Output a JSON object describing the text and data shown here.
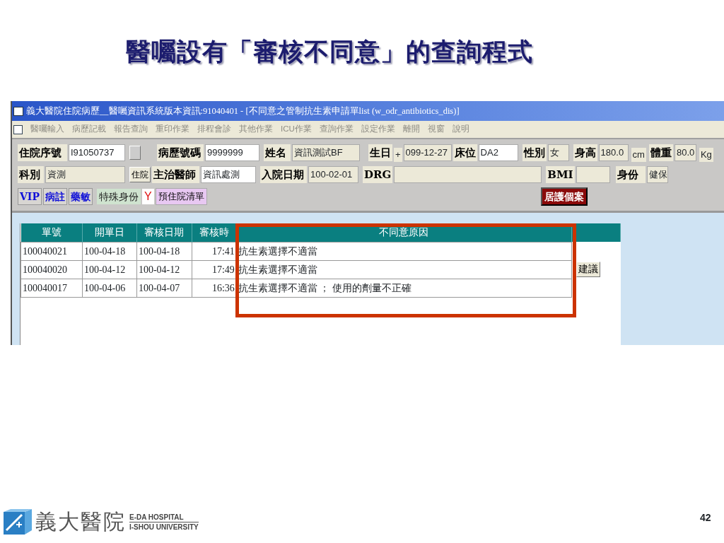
{
  "slide_title": "醫囑設有「審核不同意」的查詢程式",
  "window": {
    "title": "義大醫院住院病歷__醫囑資訊系統版本資訊:91040401 - [不同意之管制抗生素申請單list (w_odr_antibiotics_dis)]"
  },
  "menu": [
    "醫囑輸入",
    "病歷記載",
    "報告查詢",
    "重印作業",
    "排程會診",
    "其他作業",
    "ICU作業",
    "查詢作業",
    "設定作業",
    "離開",
    "視窗",
    "說明"
  ],
  "form_rows": [
    [
      {
        "kind": "label",
        "text": "住院序號"
      },
      {
        "kind": "field",
        "text": "I91050737",
        "readonly": false
      },
      {
        "kind": "blank-button"
      },
      {
        "kind": "label",
        "text": "病歷號碼"
      },
      {
        "kind": "field",
        "text": "9999999",
        "readonly": false
      },
      {
        "kind": "label",
        "text": "姓名"
      },
      {
        "kind": "field",
        "text": "資訊測試BF",
        "readonly": true
      },
      {
        "kind": "label",
        "text": "生日"
      },
      {
        "kind": "unit",
        "text": "+"
      },
      {
        "kind": "field",
        "text": "099-12-27",
        "readonly": true
      },
      {
        "kind": "label",
        "text": "床位"
      },
      {
        "kind": "field",
        "text": "DA2",
        "readonly": false
      },
      {
        "kind": "label",
        "text": "性別"
      },
      {
        "kind": "field",
        "text": "女",
        "readonly": true
      },
      {
        "kind": "label",
        "text": "身高"
      },
      {
        "kind": "field",
        "text": "180.0",
        "readonly": true
      },
      {
        "kind": "unit",
        "text": "cm"
      },
      {
        "kind": "label",
        "text": "體重"
      },
      {
        "kind": "field",
        "text": "80.0",
        "readonly": true
      },
      {
        "kind": "unit",
        "text": "Kg"
      }
    ],
    [
      {
        "kind": "label",
        "text": "科別"
      },
      {
        "kind": "field",
        "text": "資測",
        "readonly": true
      },
      {
        "kind": "small-button",
        "text": "住院"
      },
      {
        "kind": "label",
        "text": "主治醫師"
      },
      {
        "kind": "field",
        "text": "資訊處測",
        "readonly": false
      },
      {
        "kind": "label",
        "text": "入院日期"
      },
      {
        "kind": "field",
        "text": "100-02-01",
        "readonly": true
      },
      {
        "kind": "label",
        "text": "DRG"
      },
      {
        "kind": "field",
        "readonly": true
      },
      {
        "kind": "label",
        "text": "BMI"
      },
      {
        "kind": "field",
        "readonly": true
      },
      {
        "kind": "label",
        "text": "身份"
      },
      {
        "kind": "field",
        "text": "健保",
        "readonly": true
      }
    ],
    [
      {
        "kind": "alert-button",
        "text": "VIP"
      },
      {
        "kind": "alert-button",
        "text": "病註"
      },
      {
        "kind": "alert-button",
        "text": "藥敏"
      },
      {
        "kind": "special-label",
        "text": "特殊身份"
      },
      {
        "kind": "flag",
        "text": "Y"
      },
      {
        "kind": "list-button",
        "text": "預住院清單"
      },
      {
        "kind": "case-button",
        "text": "居護個案"
      }
    ]
  ],
  "table": {
    "columns": [
      "單號",
      "開單日",
      "審核日期",
      "審核時",
      "不同意原因"
    ],
    "rows": [
      [
        "100040021",
        "100-04-18",
        "100-04-18",
        "17:41",
        "抗生素選擇不適當"
      ],
      [
        "100040020",
        "100-04-12",
        "100-04-12",
        "17:49",
        "抗生素選擇不適當"
      ],
      [
        "100040017",
        "100-04-06",
        "100-04-07",
        "16:36",
        "抗生素選擇不適當 ； 使用的劑量不正確"
      ]
    ],
    "suggest_button": "建議"
  },
  "footer": {
    "logo_name": "義大醫院",
    "logo_line_1": "E-DA HOSPITAL",
    "logo_line_2": "I-SHOU UNIVERSITY",
    "page_number": "42"
  }
}
